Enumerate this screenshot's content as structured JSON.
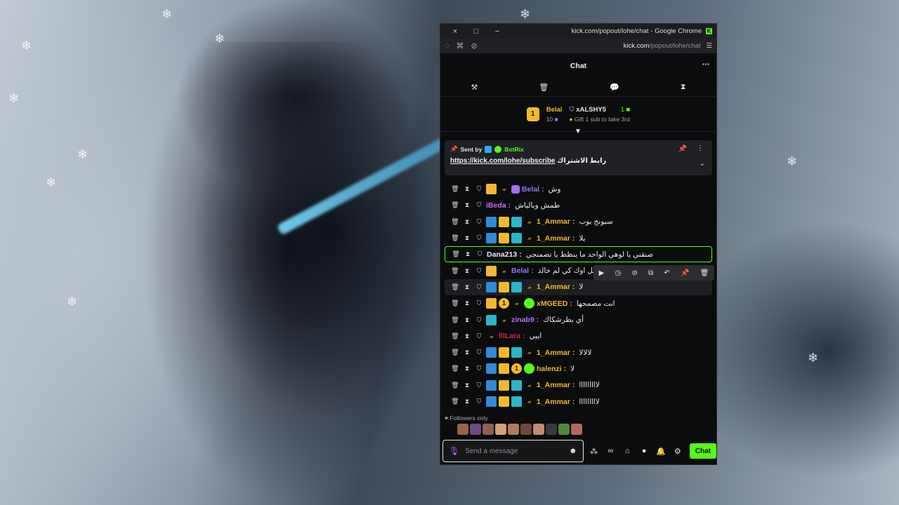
{
  "window": {
    "close_icon": "×",
    "restore_icon": "□",
    "minimize_icon": "−",
    "title": "kick.com/popout/lohe/chat - Google Chrome",
    "logo_letter": "K"
  },
  "address_bar": {
    "host": "kick.com",
    "path": "/popout/lohe/chat"
  },
  "chat": {
    "title": "Chat",
    "more_icon": "⋯"
  },
  "toolbar": {
    "hammer_icon": "⚒",
    "trash_icon": "🗑",
    "chat_icon": "💬",
    "timer_icon": "⧗"
  },
  "leaderboard": {
    "rank": "1",
    "first_name": "Belal",
    "first_count": "10",
    "second_name": "xALSHY5",
    "second_count": "1",
    "gift_text": "Gift 1 sub to take 3rd"
  },
  "pinned": {
    "sent_by_label": "Sent by",
    "bot_name": "BotRix",
    "link": "https://kick.com/lohe/subscribe",
    "link_suffix": "رابط الاشتراك"
  },
  "messages": [
    {
      "username": "Belal",
      "color": "#8b7cf6",
      "text": "وش",
      "badges": [
        "crown",
        "gift",
        "gift-p"
      ]
    },
    {
      "username": "iBeda",
      "color": "#c46cf5",
      "text": "طمش وبالياش",
      "badges": []
    },
    {
      "username": "1_Ammar",
      "color": "#f5b82e",
      "text": "سبونج بوب",
      "badges": [
        "mod",
        "crown",
        "sub",
        "gift"
      ]
    },
    {
      "username": "1_Ammar",
      "color": "#f5b82e",
      "text": "يلا",
      "badges": [
        "mod",
        "crown",
        "sub",
        "gift"
      ]
    },
    {
      "username": "Dana213",
      "color": "#e8e9eb",
      "text": "صنقني يا لوهي الواحد ما ينظط يا تصمنجي",
      "badges": []
    },
    {
      "username": "Belal",
      "color": "#8b7cf6",
      "text": "سلمل اوك كي لم خالد",
      "badges": [
        "crown",
        "gift"
      ]
    },
    {
      "username": "1_Ammar",
      "color": "#f5b82e",
      "text": "لا",
      "badges": [
        "mod",
        "crown",
        "sub",
        "gift"
      ]
    },
    {
      "username": "xMGEED",
      "color": "#f5b82e",
      "text": "انت مصمجها",
      "badges": [
        "crown",
        "num",
        "gift",
        "verified"
      ]
    },
    {
      "username": "zinab9",
      "color": "#c46cf5",
      "text": "أي بطرشكاك",
      "badges": [
        "sub",
        "gift"
      ]
    },
    {
      "username": "lllLara",
      "color": "#e0203c",
      "text": "اييي",
      "badges": [
        "gift"
      ]
    },
    {
      "username": "1_Ammar",
      "color": "#f5b82e",
      "text": "لالالا",
      "badges": [
        "mod",
        "crown",
        "sub",
        "gift"
      ]
    },
    {
      "username": "halenzi",
      "color": "#f5b82e",
      "text": "لا",
      "badges": [
        "mod",
        "crown",
        "num",
        "verified"
      ]
    },
    {
      "username": "1_Ammar",
      "color": "#f5b82e",
      "text": "لااااااااا",
      "badges": [
        "mod",
        "crown",
        "sub",
        "gift"
      ]
    },
    {
      "username": "1_Ammar",
      "color": "#f5b82e",
      "text": "لااااااااا",
      "badges": [
        "mod",
        "crown",
        "sub",
        "gift"
      ]
    }
  ],
  "message_icons": {
    "delete_icon": "🗑",
    "timeout_icon": "⧗",
    "shield_icon": "⛉"
  },
  "hover_toolbar_icons": [
    "▶",
    "◷",
    "⊘",
    "⧉",
    "↶",
    "📌",
    "🗑"
  ],
  "followers": {
    "label": "Followers only",
    "heart_icon": "♥"
  },
  "avatar_colors": [
    "#a15f48",
    "#6c4a82",
    "#8f5d54",
    "#d2a178",
    "#b07b59",
    "#6a4a3a",
    "#c28a74",
    "#3a3a3a",
    "#4e8a3a",
    "#b8665c"
  ],
  "input": {
    "placeholder": "Send a message",
    "mic_icon": "🎙",
    "emoji_icon": "☻"
  },
  "input_tools": {
    "infinity_icon": "∞",
    "store_icon": "⌂",
    "bubble_icon": "●",
    "bell_icon": "🔔",
    "gear_icon": "⚙"
  },
  "send_button_label": "Chat",
  "colors": {
    "accent": "#53fc18",
    "gold": "#f5b82e"
  }
}
